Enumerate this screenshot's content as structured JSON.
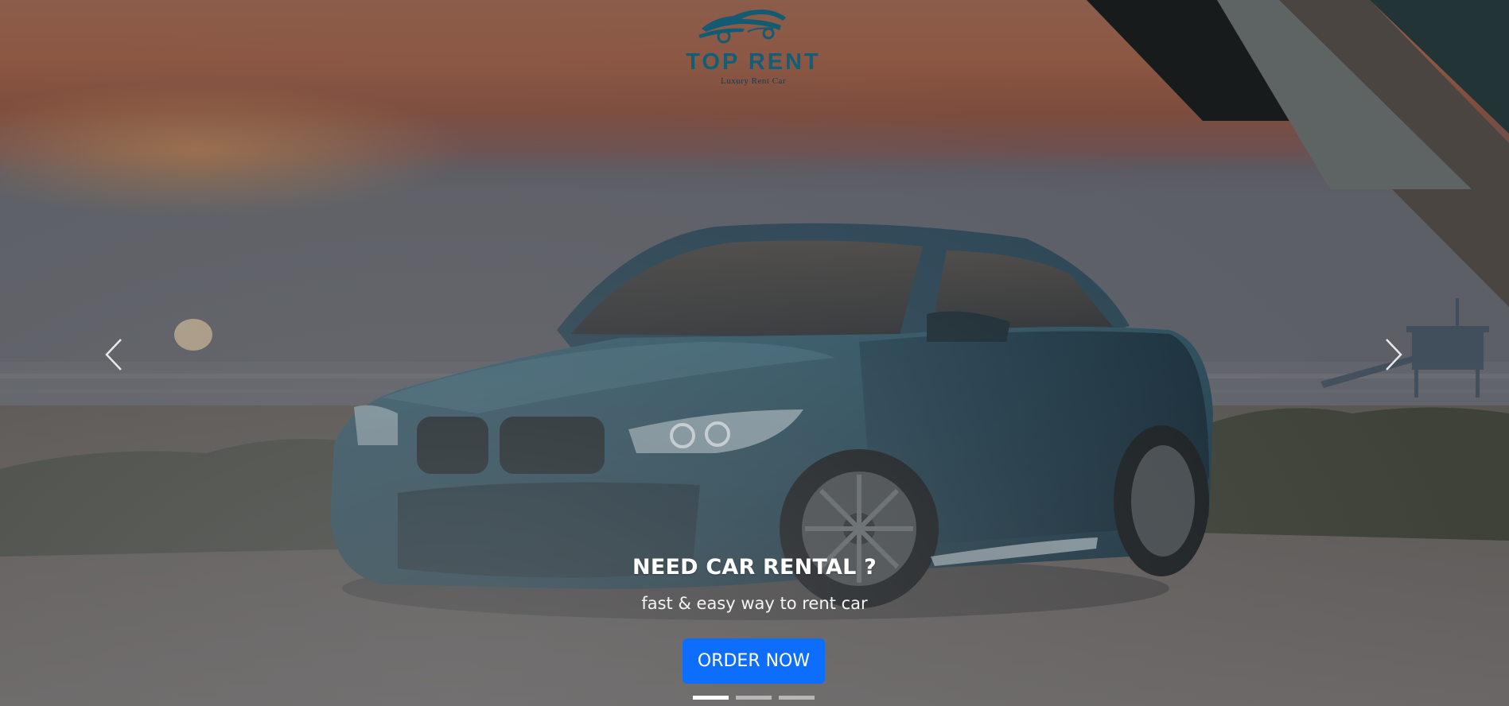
{
  "brand": {
    "name": "TOP RENT",
    "tagline": "Luxury Rent Car",
    "logo_icon": "car-logo-icon",
    "color": "#0f5f79"
  },
  "carousel": {
    "prev_icon": "chevron-left-icon",
    "next_icon": "chevron-right-icon",
    "slides_count": 3,
    "active_index": 0,
    "caption": {
      "title": "NEED CAR RENTAL ?",
      "subtitle": "fast & easy way to rent car",
      "button_label": "ORDER NOW"
    }
  },
  "colors": {
    "button": "#0d6efd",
    "caption_text": "#ffffff",
    "sky_top": "#8a5a48",
    "sky_glow": "#9a4f35",
    "car_body": "#2e5365",
    "stripe_dark": "#171b1b",
    "stripe_grey": "#5e6463",
    "stripe_brown": "#4a4540",
    "stripe_teal": "#233436"
  }
}
